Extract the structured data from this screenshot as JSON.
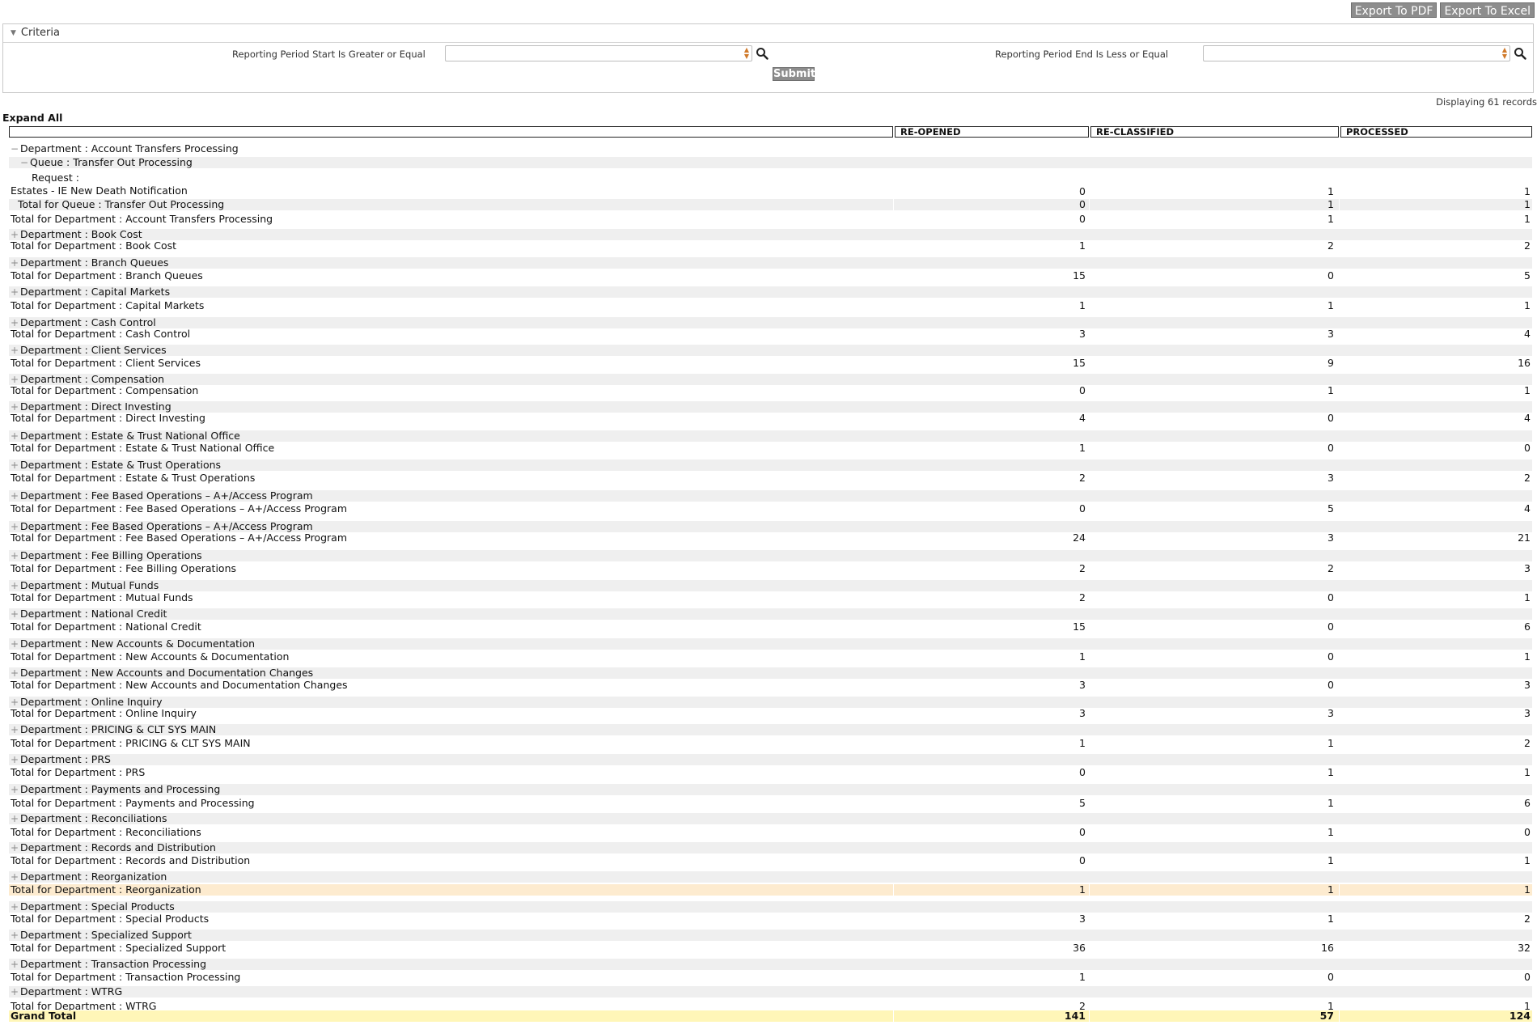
{
  "toolbar": {
    "export_pdf": "Export To PDF",
    "export_excel": "Export To Excel"
  },
  "criteria": {
    "title": "Criteria",
    "start_label": "Reporting Period Start  Is Greater or Equal",
    "start_value": "",
    "end_label": "Reporting Period End  Is Less or Equal",
    "end_value": "",
    "submit": "Submit"
  },
  "records_text": "Displaying 61 records",
  "expand_all": "Expand All",
  "columns": [
    "",
    "RE-OPENED",
    "RE-CLASSIFIED",
    "PROCESSED"
  ],
  "rows": [
    {
      "label": "Department : Account Transfers Processing",
      "kind": "group",
      "toggle": "−",
      "indent": 0
    },
    {
      "label": "Queue : Transfer Out Processing",
      "kind": "group",
      "toggle": "−",
      "indent": 1
    },
    {
      "label": "Request :",
      "label2": "Estates - IE New Death Notification",
      "kind": "request",
      "values": [
        "0",
        "1",
        "1"
      ]
    },
    {
      "label": "Total for Queue : Transfer Out Processing",
      "kind": "total",
      "indent": 1,
      "values": [
        "0",
        "1",
        "1"
      ]
    },
    {
      "label": "Total for Department : Account Transfers Processing",
      "kind": "total",
      "values": [
        "0",
        "1",
        "1"
      ]
    },
    {
      "label": "Department : Book Cost",
      "kind": "group",
      "toggle": "+",
      "indent": 0
    },
    {
      "label": "Total for Department : Book Cost",
      "kind": "total",
      "values": [
        "1",
        "2",
        "2"
      ]
    },
    {
      "label": "Department : Branch Queues",
      "kind": "group",
      "toggle": "+",
      "indent": 0
    },
    {
      "label": "Total for Department : Branch Queues",
      "kind": "total",
      "values": [
        "15",
        "0",
        "5"
      ]
    },
    {
      "label": "Department : Capital Markets",
      "kind": "group",
      "toggle": "+",
      "indent": 0
    },
    {
      "label": "Total for Department : Capital Markets",
      "kind": "total",
      "values": [
        "1",
        "1",
        "1"
      ]
    },
    {
      "label": "Department : Cash Control",
      "kind": "group",
      "toggle": "+",
      "indent": 0
    },
    {
      "label": "Total for Department : Cash Control",
      "kind": "total",
      "values": [
        "3",
        "3",
        "4"
      ]
    },
    {
      "label": "Department : Client Services",
      "kind": "group",
      "toggle": "+",
      "indent": 0
    },
    {
      "label": "Total for Department : Client Services",
      "kind": "total",
      "values": [
        "15",
        "9",
        "16"
      ]
    },
    {
      "label": "Department : Compensation",
      "kind": "group",
      "toggle": "+",
      "indent": 0
    },
    {
      "label": "Total for Department : Compensation",
      "kind": "total",
      "values": [
        "0",
        "1",
        "1"
      ]
    },
    {
      "label": "Department : Direct Investing",
      "kind": "group",
      "toggle": "+",
      "indent": 0
    },
    {
      "label": "Total for Department : Direct Investing",
      "kind": "total",
      "values": [
        "4",
        "0",
        "4"
      ]
    },
    {
      "label": "Department : Estate & Trust National Office",
      "kind": "group",
      "toggle": "+",
      "indent": 0
    },
    {
      "label": "Total for Department : Estate & Trust National Office",
      "kind": "total",
      "values": [
        "1",
        "0",
        "0"
      ]
    },
    {
      "label": "Department : Estate & Trust Operations",
      "kind": "group",
      "toggle": "+",
      "indent": 0
    },
    {
      "label": "Total for Department : Estate & Trust Operations",
      "kind": "total",
      "values": [
        "2",
        "3",
        "2"
      ]
    },
    {
      "label": "Department : Fee Based Operations – A+/Access Program",
      "kind": "group",
      "toggle": "+",
      "indent": 0
    },
    {
      "label": "Total for Department : Fee Based Operations – A+/Access Program",
      "kind": "total",
      "values": [
        "0",
        "5",
        "4"
      ]
    },
    {
      "label": "Department : Fee Based Operations – A+/Access Program",
      "kind": "group",
      "toggle": "+",
      "indent": 0
    },
    {
      "label": "Total for Department : Fee Based Operations – A+/Access Program",
      "kind": "total",
      "values": [
        "24",
        "3",
        "21"
      ]
    },
    {
      "label": "Department : Fee Billing Operations",
      "kind": "group",
      "toggle": "+",
      "indent": 0
    },
    {
      "label": "Total for Department : Fee Billing Operations",
      "kind": "total",
      "values": [
        "2",
        "2",
        "3"
      ]
    },
    {
      "label": "Department : Mutual Funds",
      "kind": "group",
      "toggle": "+",
      "indent": 0
    },
    {
      "label": "Total for Department : Mutual Funds",
      "kind": "total",
      "values": [
        "2",
        "0",
        "1"
      ]
    },
    {
      "label": "Department : National Credit",
      "kind": "group",
      "toggle": "+",
      "indent": 0
    },
    {
      "label": "Total for Department : National Credit",
      "kind": "total",
      "values": [
        "15",
        "0",
        "6"
      ]
    },
    {
      "label": "Department : New Accounts & Documentation",
      "kind": "group",
      "toggle": "+",
      "indent": 0
    },
    {
      "label": "Total for Department : New Accounts & Documentation",
      "kind": "total",
      "values": [
        "1",
        "0",
        "1"
      ]
    },
    {
      "label": "Department : New Accounts and Documentation Changes",
      "kind": "group",
      "toggle": "+",
      "indent": 0
    },
    {
      "label": "Total for Department : New Accounts and Documentation Changes",
      "kind": "total",
      "values": [
        "3",
        "0",
        "3"
      ]
    },
    {
      "label": "Department : Online Inquiry",
      "kind": "group",
      "toggle": "+",
      "indent": 0
    },
    {
      "label": "Total for Department : Online Inquiry",
      "kind": "total",
      "values": [
        "3",
        "3",
        "3"
      ]
    },
    {
      "label": "Department : PRICING & CLT SYS MAIN",
      "kind": "group",
      "toggle": "+",
      "indent": 0
    },
    {
      "label": "Total for Department : PRICING & CLT SYS MAIN",
      "kind": "total",
      "values": [
        "1",
        "1",
        "2"
      ]
    },
    {
      "label": "Department : PRS",
      "kind": "group",
      "toggle": "+",
      "indent": 0
    },
    {
      "label": "Total for Department : PRS",
      "kind": "total",
      "values": [
        "0",
        "1",
        "1"
      ]
    },
    {
      "label": "Department : Payments and Processing",
      "kind": "group",
      "toggle": "+",
      "indent": 0
    },
    {
      "label": "Total for Department : Payments and Processing",
      "kind": "total",
      "values": [
        "5",
        "1",
        "6"
      ]
    },
    {
      "label": "Department : Reconciliations",
      "kind": "group",
      "toggle": "+",
      "indent": 0
    },
    {
      "label": "Total for Department : Reconciliations",
      "kind": "total",
      "values": [
        "0",
        "1",
        "0"
      ]
    },
    {
      "label": "Department : Records and Distribution",
      "kind": "group",
      "toggle": "+",
      "indent": 0
    },
    {
      "label": "Total for Department : Records and Distribution",
      "kind": "total",
      "values": [
        "0",
        "1",
        "1"
      ]
    },
    {
      "label": "Department : Reorganization",
      "kind": "group",
      "toggle": "+",
      "indent": 0
    },
    {
      "label": "Total for Department : Reorganization",
      "kind": "total",
      "highlight": true,
      "values": [
        "1",
        "1",
        "1"
      ]
    },
    {
      "label": "Department : Special Products",
      "kind": "group",
      "toggle": "+",
      "indent": 0
    },
    {
      "label": "Total for Department : Special Products",
      "kind": "total",
      "values": [
        "3",
        "1",
        "2"
      ]
    },
    {
      "label": "Department : Specialized Support",
      "kind": "group",
      "toggle": "+",
      "indent": 0
    },
    {
      "label": "Total for Department : Specialized Support",
      "kind": "total",
      "values": [
        "36",
        "16",
        "32"
      ]
    },
    {
      "label": "Department : Transaction Processing",
      "kind": "group",
      "toggle": "+",
      "indent": 0
    },
    {
      "label": "Total for Department : Transaction Processing",
      "kind": "total",
      "values": [
        "1",
        "0",
        "0"
      ]
    },
    {
      "label": "Department : WTRG",
      "kind": "group",
      "toggle": "+",
      "indent": 0
    },
    {
      "label": "Total for Department : WTRG",
      "kind": "total",
      "values": [
        "2",
        "1",
        "1"
      ]
    },
    {
      "label": "Grand Total",
      "kind": "grand",
      "values": [
        "141",
        "57",
        "124"
      ]
    }
  ]
}
